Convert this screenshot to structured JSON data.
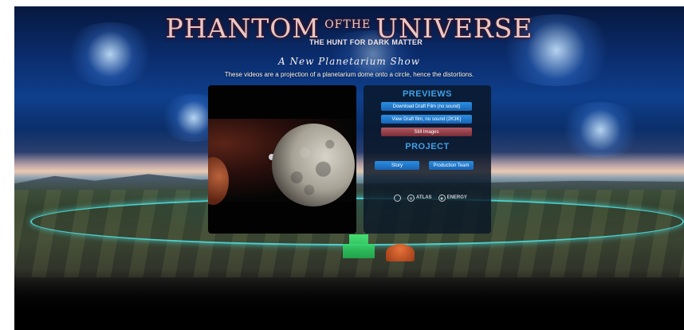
{
  "header": {
    "title_phantom": "PHANTOM",
    "title_of": "OF",
    "title_the": "THE",
    "title_universe": "UNIVERSE",
    "subtitle": "THE HUNT FOR DARK MATTER",
    "show_name": "A New Planetarium Show",
    "note": "These videos are a projection of a planetarium dome onto a circle, hence the distortions."
  },
  "previews": {
    "heading": "PREVIEWS",
    "buttons": [
      {
        "label": "Download Draft Film (no sound)"
      },
      {
        "label": "View Draft film, no sound (2K3K)"
      },
      {
        "label": "Still Images"
      }
    ]
  },
  "project": {
    "heading": "PROJECT",
    "buttons": [
      {
        "label": "Story"
      },
      {
        "label": "Production Team"
      }
    ]
  },
  "logos": {
    "atlas": "ATLAS",
    "energy": "ENERGY"
  },
  "colors": {
    "accent_blue": "#2d8ee0",
    "heading_blue": "#3fa0e8",
    "still_images_red": "#9a3f48",
    "ring_cyan": "#50e6e6"
  }
}
